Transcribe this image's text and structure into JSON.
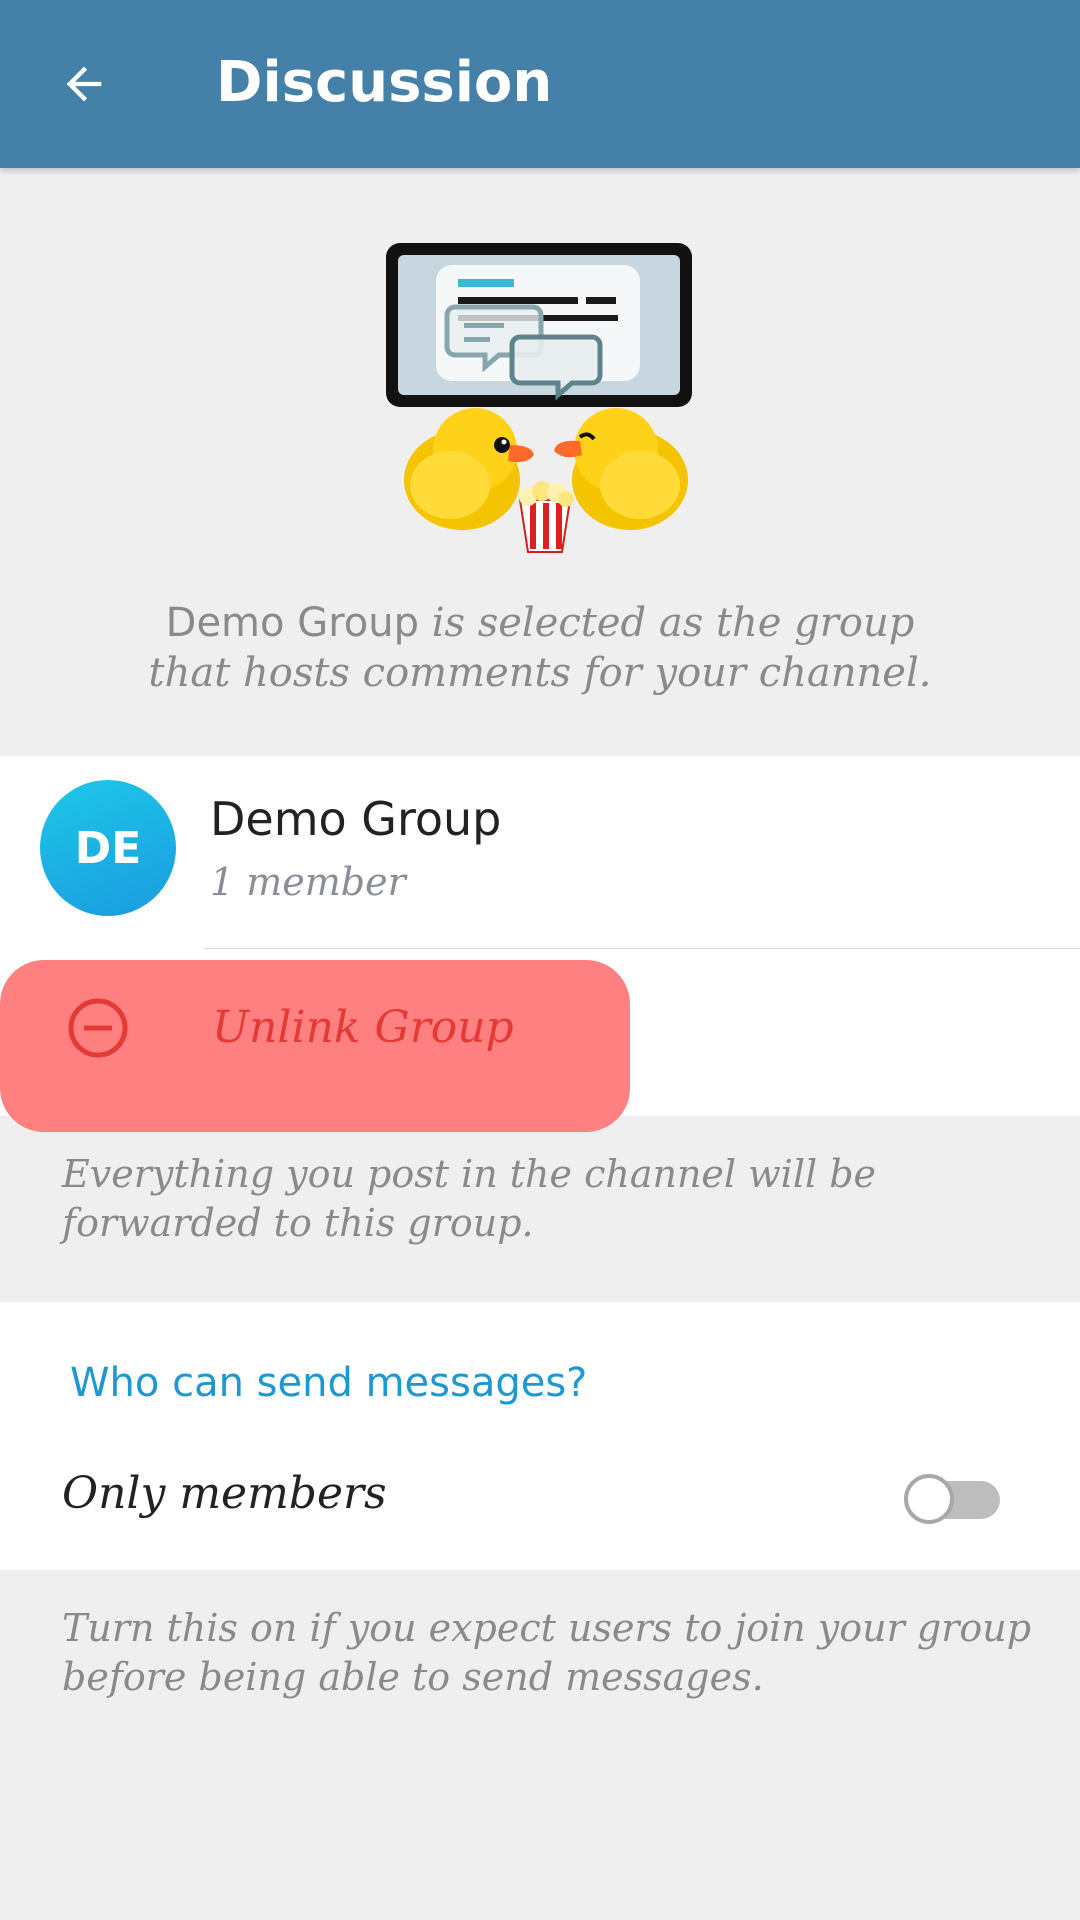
{
  "appbar": {
    "title": "Discussion"
  },
  "info": {
    "group_name": "Demo Group",
    "text": " is selected as the group that hosts comments for your channel."
  },
  "group": {
    "avatar_initials": "DE",
    "name": "Demo Group",
    "members": "1 member",
    "avatar_colors": [
      "#1ec8e8",
      "#1a9be0"
    ]
  },
  "unlink": {
    "label": "Unlink Group",
    "color": "#e53935",
    "highlight": "#ff8080"
  },
  "notes": {
    "forward": "Everything you post in the channel will be forwarded to this group.",
    "members_hint": "Turn this on if you expect users to join your group before being able to send messages."
  },
  "permissions": {
    "header": "Who can send messages?",
    "option_label": "Only members",
    "option_enabled": false
  },
  "colors": {
    "appbar": "#4580a8",
    "accent": "#1e98d2",
    "background": "#efefef"
  },
  "icons": [
    "arrow-back-icon",
    "discussion-illustration",
    "minus-circle-icon"
  ]
}
